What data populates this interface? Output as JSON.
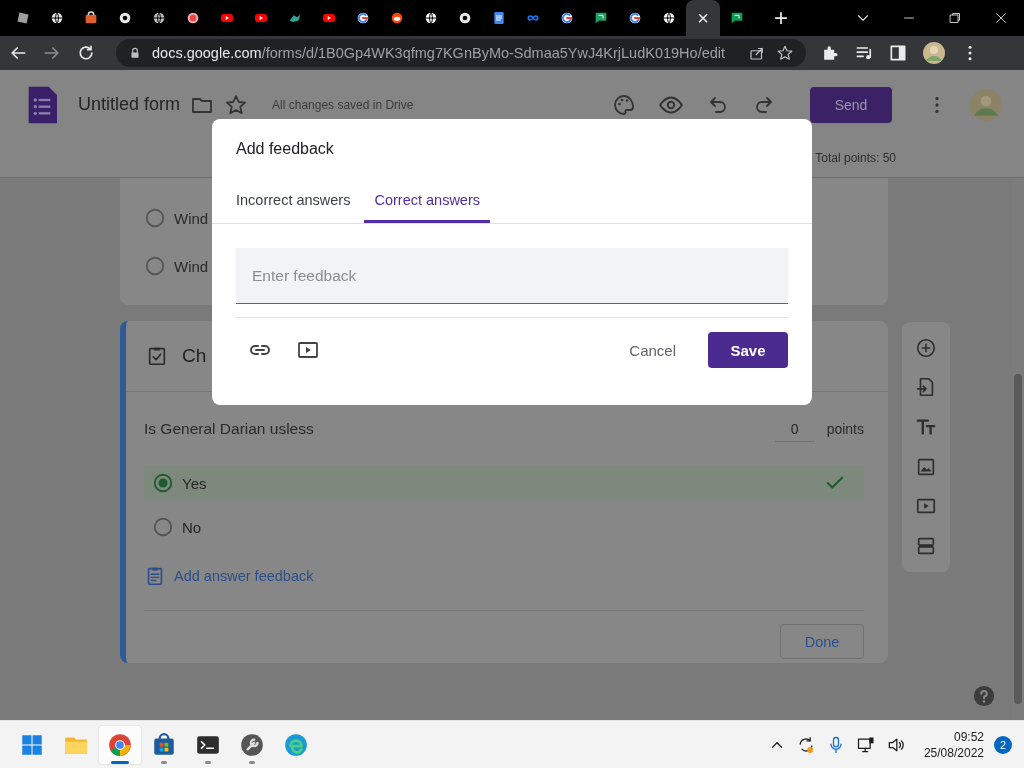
{
  "browser": {
    "tabs": [
      {
        "kind": "square",
        "color": "#9e9e9e",
        "selected": false
      },
      {
        "kind": "globe",
        "color": "#e8e8e8",
        "selected": false
      },
      {
        "kind": "store",
        "color": "#e0602c",
        "selected": false
      },
      {
        "kind": "chrome",
        "color": "#e8e8e8",
        "selected": false
      },
      {
        "kind": "globe",
        "color": "#bdbdbd",
        "selected": false
      },
      {
        "kind": "record",
        "color": "#e84545",
        "selected": false
      },
      {
        "kind": "youtube",
        "color": "#ff0000",
        "selected": false
      },
      {
        "kind": "youtube",
        "color": "#ff0000",
        "selected": false
      },
      {
        "kind": "bird",
        "color": "#2fa59a",
        "selected": false
      },
      {
        "kind": "youtube",
        "color": "#ff0000",
        "selected": false
      },
      {
        "kind": "g",
        "color": "#4285f4",
        "selected": false
      },
      {
        "kind": "circle",
        "color": "#ff4500",
        "selected": false
      },
      {
        "kind": "globe",
        "color": "#ffffff",
        "selected": false
      },
      {
        "kind": "chrome",
        "color": "#e8e8e8",
        "selected": false
      },
      {
        "kind": "doc",
        "color": "#4285f4",
        "selected": false
      },
      {
        "kind": "meta",
        "color": "#1877f2",
        "selected": false
      },
      {
        "kind": "g",
        "color": "#4285f4",
        "selected": false
      },
      {
        "kind": "chat",
        "color": "#1ea362",
        "selected": false
      },
      {
        "kind": "g",
        "color": "#4285f4",
        "selected": false
      },
      {
        "kind": "globe",
        "color": "#ffffff",
        "selected": false
      },
      {
        "kind": "none",
        "selected": true,
        "close": "×"
      },
      {
        "kind": "chat",
        "color": "#0f9d58",
        "selected": false
      }
    ],
    "new_tab": "+",
    "url_host": "docs.google.com",
    "url_path": "/forms/d/1B0Gp4WK3qfmg7KGnByMo-Sdmaa5YwJ4KrjLudK019Ho/edit"
  },
  "form_header": {
    "title": "Untitled form",
    "save_status": "All changes saved in Drive",
    "send": "Send",
    "total_points": "Total points: 50"
  },
  "first_card": {
    "options": [
      {
        "label": "Wind",
        "selected": false
      },
      {
        "label": "Wind",
        "selected": false
      }
    ]
  },
  "question_card": {
    "title": "Ch",
    "question": "Is General Darian usless",
    "points_value": "0",
    "points_label": "points",
    "options": [
      {
        "label": "Yes",
        "selected": true,
        "correct": true
      },
      {
        "label": "No",
        "selected": false,
        "correct": false
      }
    ],
    "feedback_link": "Add answer feedback",
    "done": "Done"
  },
  "dialog": {
    "title": "Add feedback",
    "tabs": [
      {
        "label": "Incorrect answers",
        "selected": false
      },
      {
        "label": "Correct answers",
        "selected": true
      }
    ],
    "placeholder": "Enter feedback",
    "cancel": "Cancel",
    "save": "Save"
  },
  "taskbar": {
    "apps": [
      {
        "kind": "start",
        "selected": false,
        "running": false
      },
      {
        "kind": "folder",
        "selected": false,
        "running": false
      },
      {
        "kind": "chrome",
        "selected": true,
        "running": true
      },
      {
        "kind": "store",
        "selected": false,
        "running": true
      },
      {
        "kind": "terminal",
        "selected": false,
        "running": true
      },
      {
        "kind": "tool",
        "selected": false,
        "running": true
      },
      {
        "kind": "edge",
        "selected": false,
        "running": false
      }
    ],
    "time": "09:52",
    "date": "25/08/2022",
    "notifications": "2"
  }
}
